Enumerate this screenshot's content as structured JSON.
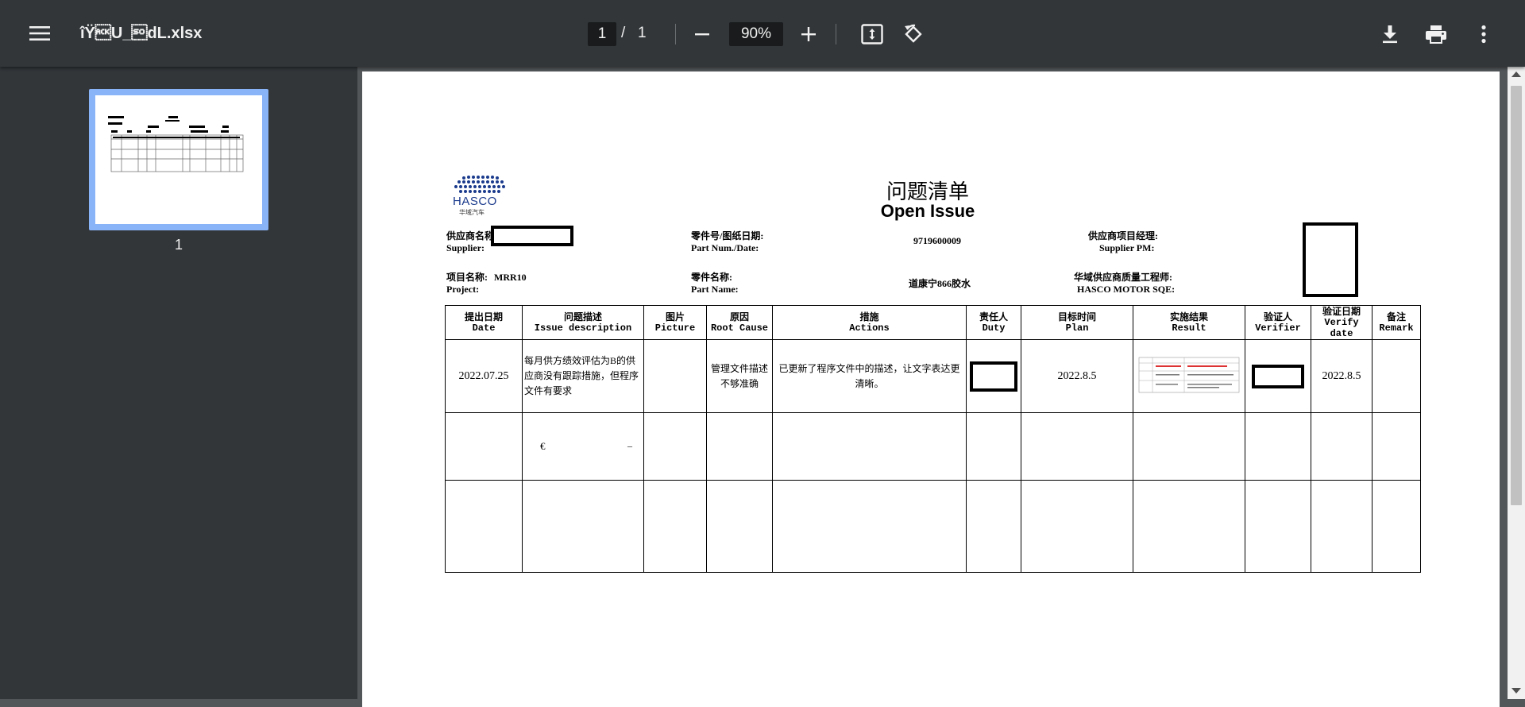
{
  "toolbar": {
    "filename": "îŸ\u0006U_\u000edL.xlsx",
    "page_current": "1",
    "page_separator": "/",
    "page_total": "1",
    "zoom": "90%",
    "icons": [
      "menu-icon",
      "zoom-out-icon",
      "zoom-in-icon",
      "fit-page-icon",
      "rotate-icon",
      "download-icon",
      "print-icon",
      "more-vert-icon"
    ]
  },
  "sidebar": {
    "thumbnails": [
      {
        "label": "1"
      }
    ]
  },
  "document": {
    "logo_text": "HASCO",
    "logo_subtext": "华域汽车",
    "title_cn": "问题清单",
    "title_en": "Open Issue",
    "supplier_cn": "供应商名称:",
    "supplier_en": "Supplier:",
    "partnum_cn": "零件号/图纸日期:",
    "partnum_en": "Part Num./Date:",
    "partnum_value": "9719600009",
    "pm_cn": "供应商项目经理:",
    "pm_en": "Supplier PM:",
    "project_cn": "项目名称:",
    "project_value": "MRR10",
    "project_en": "Project:",
    "partname_cn": "零件名称:",
    "partname_en": "Part Name:",
    "partname_value": "道康宁866胶水",
    "sqe_cn": "华域供应商质量工程师:",
    "sqe_en": "HASCO MOTOR SQE:",
    "headers": [
      {
        "cn": "提出日期",
        "en": "Date"
      },
      {
        "cn": "问题描述",
        "en": "Issue description"
      },
      {
        "cn": "图片",
        "en": "Picture"
      },
      {
        "cn": "原因",
        "en": "Root Cause"
      },
      {
        "cn": "措施",
        "en": "Actions"
      },
      {
        "cn": "责任人",
        "en": "Duty"
      },
      {
        "cn": "目标时间",
        "en": "Plan"
      },
      {
        "cn": "实施结果",
        "en": "Result"
      },
      {
        "cn": "验证人",
        "en": "Verifier"
      },
      {
        "cn": "验证日期",
        "en": "Verify date"
      },
      {
        "cn": "备注",
        "en": "Remark"
      }
    ],
    "row1": {
      "date": "2022.07.25",
      "issue": "每月供方绩效评估为B的供应商没有跟踪措施，但程序文件有要求",
      "root_cause": "管理文件描述不够准确",
      "actions": "已更新了程序文件中的描述，让文字表达更清晰。",
      "plan": "2022.8.5",
      "verify_date": "2022.8.5"
    },
    "row2": {
      "issue_left": "€",
      "issue_right": "–"
    }
  },
  "colors": {
    "toolbar_bg": "#323639",
    "viewer_bg": "#525659",
    "thumb_highlight": "#8ab4f8"
  }
}
